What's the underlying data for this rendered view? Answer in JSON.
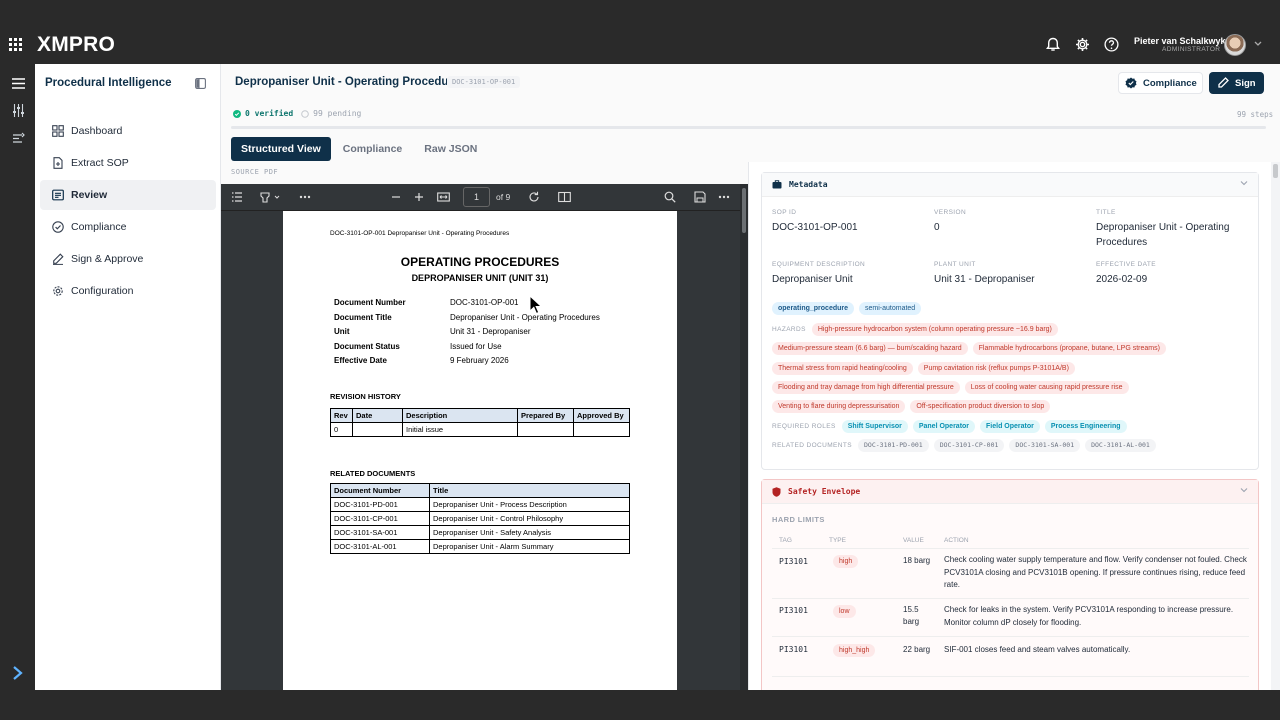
{
  "brand": {
    "logo": "XMPRO"
  },
  "user": {
    "name": "Pieter van Schalkwyk",
    "role": "ADMINISTRATOR"
  },
  "sidebar": {
    "title": "Procedural Intelligence",
    "items": [
      {
        "label": "Dashboard",
        "icon": "grid-icon"
      },
      {
        "label": "Extract SOP",
        "icon": "file-plus-icon"
      },
      {
        "label": "Review",
        "icon": "review-icon",
        "active": true
      },
      {
        "label": "Compliance",
        "icon": "check-circle-icon"
      },
      {
        "label": "Sign & Approve",
        "icon": "pen-icon"
      },
      {
        "label": "Configuration",
        "icon": "gear-icon"
      }
    ]
  },
  "header": {
    "title": "Depropaniser Unit - Operating Procedures",
    "doc_id": "DOC-3101-OP-001",
    "compliance_btn": "Compliance",
    "sign_btn": "Sign"
  },
  "status": {
    "verified": "0 verified",
    "pending": "99 pending",
    "steps": "99 steps",
    "progress": 0
  },
  "tabs": [
    "Structured View",
    "Compliance",
    "Raw JSON"
  ],
  "source_label": "SOURCE PDF",
  "pdf": {
    "page": "1",
    "of": "of 9",
    "header_line": "DOC-3101-OP-001    Depropaniser Unit - Operating Procedures",
    "title": "OPERATING PROCEDURES",
    "subtitle": "DEPROPANISER UNIT (UNIT 31)",
    "meta": [
      {
        "k": "Document Number",
        "v": "DOC-3101-OP-001"
      },
      {
        "k": "Document Title",
        "v": "Depropaniser Unit - Operating Procedures"
      },
      {
        "k": "Unit",
        "v": "Unit 31 - Depropaniser"
      },
      {
        "k": "Document Status",
        "v": "Issued for Use"
      },
      {
        "k": "Effective Date",
        "v": "9 February 2026"
      }
    ],
    "rev_title": "REVISION HISTORY",
    "rev_headers": [
      "Rev",
      "Date",
      "Description",
      "Prepared By",
      "Approved By"
    ],
    "rev_rows": [
      [
        "0",
        "",
        "Initial issue",
        "",
        ""
      ]
    ],
    "rel_title": "RELATED DOCUMENTS",
    "rel_headers": [
      "Document Number",
      "Title"
    ],
    "rel_rows": [
      [
        "DOC-3101-PD-001",
        "Depropaniser Unit - Process Description"
      ],
      [
        "DOC-3101-CP-001",
        "Depropaniser Unit - Control Philosophy"
      ],
      [
        "DOC-3101-SA-001",
        "Depropaniser Unit - Safety Analysis"
      ],
      [
        "DOC-3101-AL-001",
        "Depropaniser Unit - Alarm Summary"
      ]
    ]
  },
  "metadata": {
    "title": "Metadata",
    "sop_id_label": "SOP ID",
    "sop_id": "DOC-3101-OP-001",
    "version_label": "VERSION",
    "version": "0",
    "title_label": "TITLE",
    "title_value": "Depropaniser Unit - Operating Procedures",
    "equip_label": "EQUIPMENT DESCRIPTION",
    "equip": "Depropaniser Unit",
    "plant_label": "PLANT UNIT",
    "plant": "Unit 31 - Depropaniser",
    "eff_label": "EFFECTIVE DATE",
    "eff": "2026-02-09",
    "tags": [
      "operating_procedure",
      "semi-automated"
    ],
    "hazards_label": "HAZARDS",
    "hazards": [
      "High-pressure hydrocarbon system (column operating pressure ~16.9 barg)",
      "Medium-pressure steam (6.6 barg) — burn/scalding hazard",
      "Flammable hydrocarbons (propane, butane, LPG streams)",
      "Thermal stress from rapid heating/cooling",
      "Pump cavitation risk (reflux pumps P-3101A/B)",
      "Flooding and tray damage from high differential pressure",
      "Loss of cooling water causing rapid pressure rise",
      "Venting to flare during depressurisation",
      "Off-specification product diversion to slop"
    ],
    "roles_label": "REQUIRED ROLES",
    "roles": [
      "Shift Supervisor",
      "Panel Operator",
      "Field Operator",
      "Process Engineering"
    ],
    "related_label": "RELATED DOCUMENTS",
    "related": [
      "DOC-3101-PD-001",
      "DOC-3101-CP-001",
      "DOC-3101-SA-001",
      "DOC-3101-AL-001"
    ]
  },
  "safety": {
    "title": "Safety Envelope",
    "hard_limits": "HARD LIMITS",
    "headers": [
      "TAG",
      "TYPE",
      "VALUE",
      "ACTION"
    ],
    "rows": [
      {
        "tag": "PI3101",
        "type": "high",
        "value": "18 barg",
        "action": "Check cooling water supply temperature and flow. Verify condenser not fouled. Check PCV3101A closing and PCV3101B opening. If pressure continues rising, reduce feed rate."
      },
      {
        "tag": "PI3101",
        "type": "low",
        "value": "15.5 barg",
        "action": "Check for leaks in the system. Verify PCV3101A responding to increase pressure. Monitor column dP closely for flooding."
      },
      {
        "tag": "PI3101",
        "type": "high_high",
        "value": "22 barg",
        "action": "SIF-001 closes feed and steam valves automatically."
      }
    ]
  },
  "colors": {
    "navy": "#0f3049",
    "accent": "#5fb3ff",
    "danger": "#b42323"
  }
}
